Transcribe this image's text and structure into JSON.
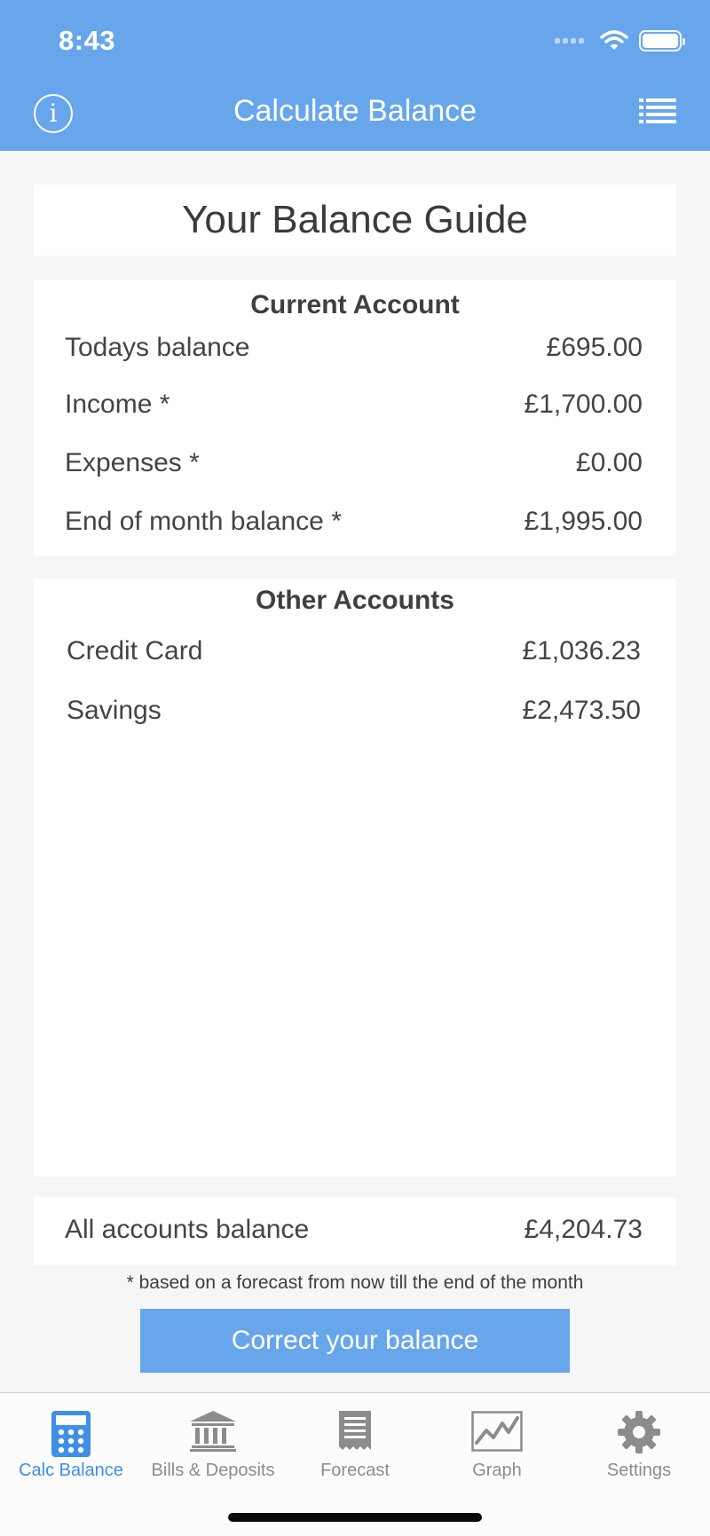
{
  "status_bar": {
    "time": "8:43"
  },
  "nav": {
    "title": "Calculate Balance",
    "info_icon": "info-icon",
    "menu_icon": "list-icon"
  },
  "guide": {
    "title": "Your Balance Guide"
  },
  "current_account": {
    "title": "Current Account",
    "rows": [
      {
        "label": "Todays balance",
        "value": "£695.00"
      },
      {
        "label": "Income *",
        "value": "£1,700.00"
      },
      {
        "label": "Expenses *",
        "value": "£0.00"
      },
      {
        "label": "End of month balance *",
        "value": "£1,995.00"
      }
    ]
  },
  "other_accounts": {
    "title": "Other Accounts",
    "rows": [
      {
        "label": "Credit Card",
        "value": "£1,036.23"
      },
      {
        "label": "Savings",
        "value": "£2,473.50"
      }
    ]
  },
  "total": {
    "label": "All accounts balance",
    "value": "£4,204.73"
  },
  "footnote": "* based on a forecast from now till the end of the month",
  "action": {
    "label": "Correct your balance"
  },
  "tabs": [
    {
      "label": "Calc Balance",
      "icon": "calculator-icon",
      "active": true
    },
    {
      "label": "Bills & Deposits",
      "icon": "bank-icon",
      "active": false
    },
    {
      "label": "Forecast",
      "icon": "receipt-icon",
      "active": false
    },
    {
      "label": "Graph",
      "icon": "graph-icon",
      "active": false
    },
    {
      "label": "Settings",
      "icon": "gear-icon",
      "active": false
    }
  ],
  "colors": {
    "accent": "#68a6ec",
    "active_tab": "#3f8fe6",
    "inactive_tab": "#8c8c8c",
    "background": "#f6f6f6"
  }
}
